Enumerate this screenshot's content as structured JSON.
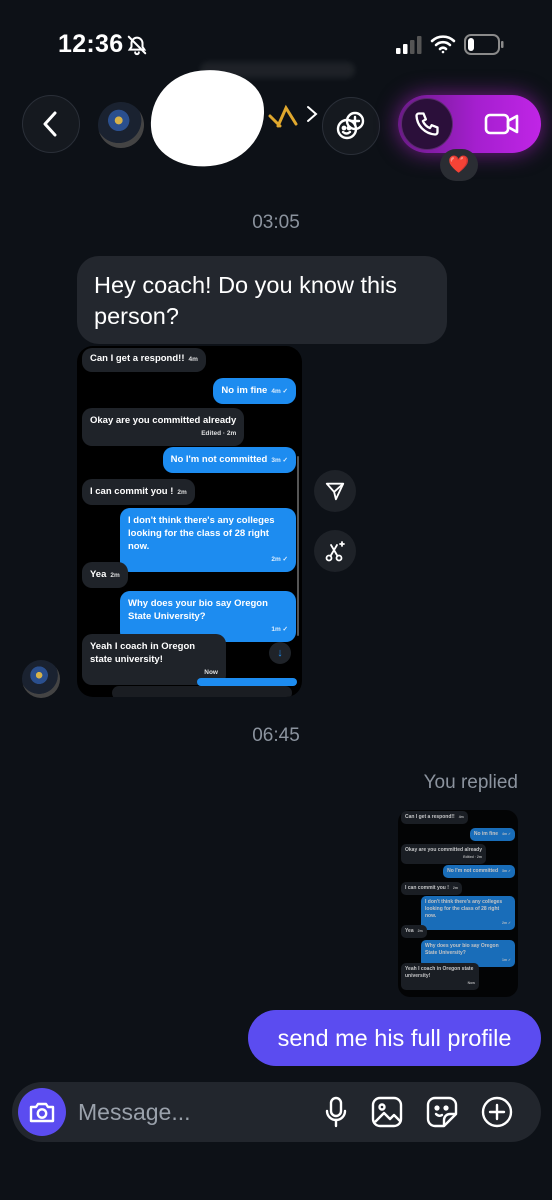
{
  "status_bar": {
    "time": "12:36"
  },
  "timestamps": {
    "first": "03:05",
    "second": "06:45"
  },
  "incoming_message": "Hey coach! Do you know this person?",
  "shared_screenshot": {
    "messages": [
      {
        "dir": "in",
        "text": "Can I get a respond!!",
        "meta": "4m"
      },
      {
        "dir": "out",
        "text": "No im fine",
        "meta": "4m ✓"
      },
      {
        "dir": "in",
        "text": "Okay are you committed already",
        "meta": "Edited · 2m"
      },
      {
        "dir": "out",
        "text": "No I'm not committed",
        "meta": "3m ✓"
      },
      {
        "dir": "in",
        "text": "I can commit you !",
        "meta": "2m"
      },
      {
        "dir": "out",
        "text": "I don't think there's any colleges looking for the class of 28 right now.",
        "meta": "2m ✓"
      },
      {
        "dir": "in",
        "text": "Yea",
        "meta": "2m"
      },
      {
        "dir": "out",
        "text": "Why does your bio say Oregon State University?",
        "meta": "1m ✓"
      },
      {
        "dir": "in",
        "text": "Yeah I coach in Oregon state university!",
        "meta": "Now"
      }
    ],
    "down_arrow": "↓"
  },
  "reply_label": "You replied",
  "outgoing_message": "send me his full profile",
  "composer": {
    "placeholder": "Message..."
  },
  "reaction": "❤️",
  "colors": {
    "accent": "#5b4cf0",
    "call_glow": "#c025e6",
    "imessage_blue": "#1d8cf0",
    "background": "#0d1117"
  },
  "icons": [
    "bell-slash-icon",
    "signal-icon",
    "wifi-icon",
    "battery-icon",
    "back-chevron-icon",
    "effects-icon",
    "phone-icon",
    "video-icon",
    "share-icon",
    "magic-icon",
    "camera-icon",
    "mic-icon",
    "image-icon",
    "sticker-icon",
    "plus-icon"
  ]
}
